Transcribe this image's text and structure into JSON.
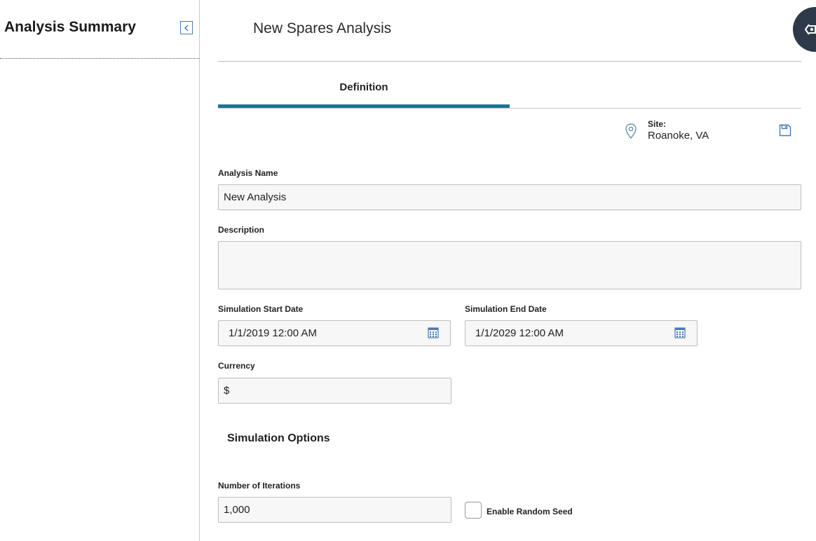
{
  "sidebar": {
    "title": "Analysis Summary"
  },
  "page": {
    "title": "New Spares Analysis"
  },
  "tabs": [
    {
      "label": "Definition",
      "active": true
    }
  ],
  "site": {
    "label": "Site:",
    "value": "Roanoke, VA"
  },
  "form": {
    "analysis_name": {
      "label": "Analysis Name",
      "value": "New Analysis"
    },
    "description": {
      "label": "Description",
      "value": ""
    },
    "start_date": {
      "label": "Simulation Start Date",
      "value": "1/1/2019 12:00 AM"
    },
    "end_date": {
      "label": "Simulation End Date",
      "value": "1/1/2029 12:00 AM"
    },
    "currency": {
      "label": "Currency",
      "value": "$"
    },
    "simulation_options": {
      "title": "Simulation Options"
    },
    "iterations": {
      "label": "Number of Iterations",
      "value": "1,000"
    },
    "random_seed": {
      "label": "Enable Random Seed",
      "checked": false
    }
  },
  "colors": {
    "accent": "#127a93",
    "icon_blue": "#4a7ab8",
    "corner_button": "#2e3a4a"
  }
}
